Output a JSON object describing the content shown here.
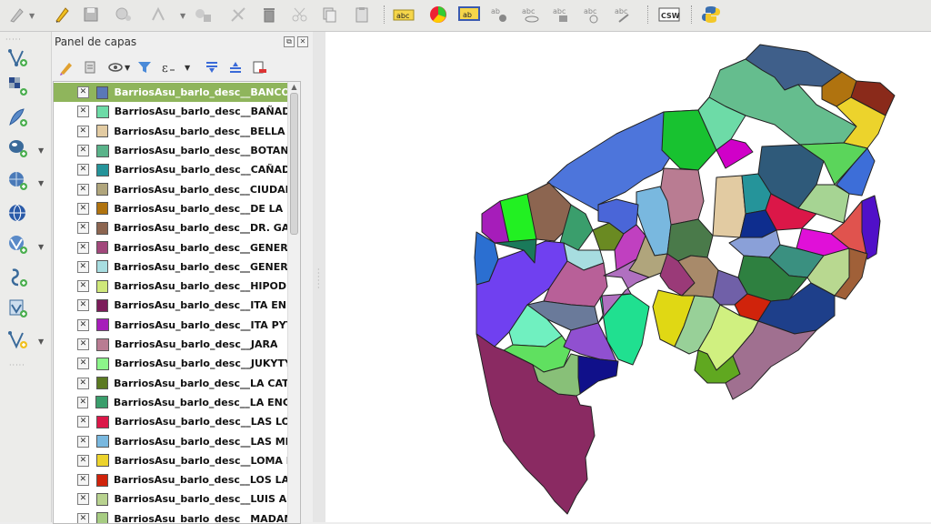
{
  "layers_panel": {
    "title": "Panel de capas",
    "layers": [
      {
        "name": "BarriosAsu_barlo_desc__BANCO ...",
        "color": "#5a78b8",
        "checked": true,
        "selected": true
      },
      {
        "name": "BarriosAsu_barlo_desc__BAÑAD...",
        "color": "#6ddba7",
        "checked": true
      },
      {
        "name": "BarriosAsu_barlo_desc__BELLA V...",
        "color": "#e2cba2",
        "checked": true
      },
      {
        "name": "BarriosAsu_barlo_desc__BOTANI...",
        "color": "#5ab38a",
        "checked": true
      },
      {
        "name": "BarriosAsu_barlo_desc__CAÑAD...",
        "color": "#25949a",
        "checked": true
      },
      {
        "name": "BarriosAsu_barlo_desc__CIUDAD ...",
        "color": "#b0a57c",
        "checked": true
      },
      {
        "name": "BarriosAsu_barlo_desc__DE LA R...",
        "color": "#b0730f",
        "checked": true
      },
      {
        "name": "BarriosAsu_barlo_desc__DR. GAS...",
        "color": "#8c6550",
        "checked": true
      },
      {
        "name": "BarriosAsu_barlo_desc__GENERA...",
        "color": "#a2487c",
        "checked": true
      },
      {
        "name": "BarriosAsu_barlo_desc__GENERA...",
        "color": "#a7dde0",
        "checked": true
      },
      {
        "name": "BarriosAsu_barlo_desc__HIPODR...",
        "color": "#cfe87a",
        "checked": true
      },
      {
        "name": "BarriosAsu_barlo_desc__ITA ENR...",
        "color": "#7c1c5a",
        "checked": true
      },
      {
        "name": "BarriosAsu_barlo_desc__ITA PYT...",
        "color": "#a61dba",
        "checked": true
      },
      {
        "name": "BarriosAsu_barlo_desc__JARA",
        "color": "#b97c92",
        "checked": true
      },
      {
        "name": "BarriosAsu_barlo_desc__JUKYTY",
        "color": "#8cf58a",
        "checked": true
      },
      {
        "name": "BarriosAsu_barlo_desc__LA CATE...",
        "color": "#5c7a22",
        "checked": true
      },
      {
        "name": "BarriosAsu_barlo_desc__LA ENCA...",
        "color": "#3a9e6c",
        "checked": true
      },
      {
        "name": "BarriosAsu_barlo_desc__LAS LO...",
        "color": "#db1748",
        "checked": true
      },
      {
        "name": "BarriosAsu_barlo_desc__LAS ME...",
        "color": "#79b8df",
        "checked": true
      },
      {
        "name": "BarriosAsu_barlo_desc__LOMA P...",
        "color": "#ecd32c",
        "checked": true
      },
      {
        "name": "BarriosAsu_barlo_desc__LOS LAU...",
        "color": "#d0230b",
        "checked": true
      },
      {
        "name": "BarriosAsu_barlo_desc__LUIS AL...",
        "color": "#b8d28f",
        "checked": true
      },
      {
        "name": "BarriosAsu_barlo_desc__MADAM...",
        "color": "#a6cc82",
        "checked": true
      }
    ]
  },
  "toolbar": {
    "labels": {
      "abc": "abc",
      "ab": "ab",
      "csw": "CSW"
    }
  },
  "check_mark": "✕",
  "map": {
    "outline_color": "#222222",
    "polygons": [
      {
        "name": "banco",
        "fill": "#3f5f8a"
      },
      {
        "name": "top-mid",
        "fill": "#65bd8e"
      },
      {
        "name": "ne-brown",
        "fill": "#b0730f"
      },
      {
        "name": "ne-red",
        "fill": "#8a2a1a"
      },
      {
        "name": "loma",
        "fill": "#ecd32c"
      },
      {
        "name": "blue-big",
        "fill": "#4d75db"
      },
      {
        "name": "green-bright",
        "fill": "#18c230"
      },
      {
        "name": "mint",
        "fill": "#6ddba7"
      },
      {
        "name": "magenta",
        "fill": "#d000c8"
      },
      {
        "name": "dark-navy",
        "fill": "#2f5a7a"
      },
      {
        "name": "green-lime",
        "fill": "#5bd55b"
      },
      {
        "name": "east-blue",
        "fill": "#3d6ed8"
      },
      {
        "name": "bella",
        "fill": "#e2cba2"
      },
      {
        "name": "pink-jara",
        "fill": "#b97c92"
      },
      {
        "name": "teal",
        "fill": "#25949a"
      },
      {
        "name": "crimson",
        "fill": "#db1748"
      },
      {
        "name": "navy",
        "fill": "#0e2d8e"
      },
      {
        "name": "light-green",
        "fill": "#a6d493"
      },
      {
        "name": "coral",
        "fill": "#e0534e"
      },
      {
        "name": "purple-east",
        "fill": "#5010c8"
      },
      {
        "name": "hot-magenta",
        "fill": "#e010d8"
      },
      {
        "name": "sky",
        "fill": "#79b8df"
      },
      {
        "name": "brown-w",
        "fill": "#8c6550"
      },
      {
        "name": "green-w",
        "fill": "#3a9e6c"
      },
      {
        "name": "lime-w",
        "fill": "#22f022"
      },
      {
        "name": "purple-nw",
        "fill": "#a61dba"
      },
      {
        "name": "blue-w",
        "fill": "#2b6fd1"
      },
      {
        "name": "violet-big",
        "fill": "#7040f0"
      },
      {
        "name": "teal-dark",
        "fill": "#1a7a5a"
      },
      {
        "name": "olive",
        "fill": "#6a8a22"
      },
      {
        "name": "blue-mid",
        "fill": "#4a66d8"
      },
      {
        "name": "orchid",
        "fill": "#c040c0"
      },
      {
        "name": "tan",
        "fill": "#b0a57c"
      },
      {
        "name": "dark-green",
        "fill": "#4a7a4a"
      },
      {
        "name": "plum",
        "fill": "#9a3a78"
      },
      {
        "name": "pale-cyan",
        "fill": "#a7dde0"
      },
      {
        "name": "mauve",
        "fill": "#b86098"
      },
      {
        "name": "gray-blue",
        "fill": "#6a7a9a"
      },
      {
        "name": "aqua",
        "fill": "#70f0c0"
      },
      {
        "name": "green-light",
        "fill": "#60e060"
      },
      {
        "name": "cyan-green",
        "fill": "#20e090"
      },
      {
        "name": "orchid2",
        "fill": "#b070c0"
      },
      {
        "name": "violet2",
        "fill": "#9050d0"
      },
      {
        "name": "deep-navy",
        "fill": "#10108a"
      },
      {
        "name": "maroon-south",
        "fill": "#8a2a62"
      },
      {
        "name": "sage",
        "fill": "#88c078"
      },
      {
        "name": "lavender",
        "fill": "#8aa0d8"
      },
      {
        "name": "brown-mid",
        "fill": "#a88a6a"
      },
      {
        "name": "teal-mid",
        "fill": "#3a9080"
      },
      {
        "name": "forest",
        "fill": "#2e8040"
      },
      {
        "name": "pale-yg",
        "fill": "#b8d890"
      },
      {
        "name": "rust",
        "fill": "#a06038"
      },
      {
        "name": "slate-purple",
        "fill": "#7060a8"
      },
      {
        "name": "yellow",
        "fill": "#e0d814"
      },
      {
        "name": "red-small",
        "fill": "#d0230b"
      },
      {
        "name": "mint2",
        "fill": "#98d098"
      },
      {
        "name": "yg",
        "fill": "#d0f080"
      },
      {
        "name": "navy2",
        "fill": "#1e3f8a"
      },
      {
        "name": "olive-green",
        "fill": "#60a820"
      },
      {
        "name": "dusty-rose",
        "fill": "#a07090"
      }
    ]
  }
}
